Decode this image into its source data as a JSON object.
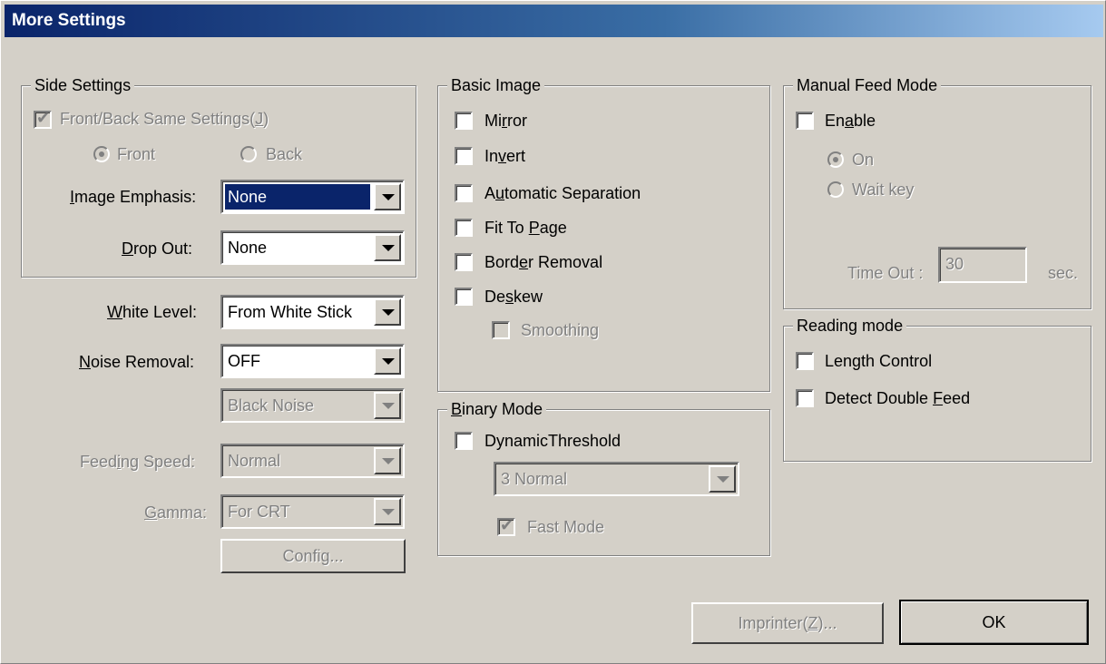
{
  "window": {
    "title": "More Settings"
  },
  "side_settings": {
    "title": "Side Settings",
    "same_settings": {
      "label_pre": "Front/Back Same Settings(",
      "label_key": "J",
      "label_post": ")",
      "checked": true,
      "enabled": false
    },
    "front": {
      "label": "Front",
      "selected": true,
      "enabled": false
    },
    "back": {
      "label": "Back",
      "selected": false,
      "enabled": false
    },
    "image_emphasis": {
      "label_pre": "",
      "label_key": "I",
      "label_post": "mage Emphasis:",
      "value": "None"
    },
    "drop_out": {
      "label_pre": "",
      "label_key": "D",
      "label_post": "rop Out:",
      "value": "None"
    }
  },
  "white_level": {
    "label_pre": "",
    "label_key": "W",
    "label_post": "hite Level:",
    "value": "From White Stick"
  },
  "noise_removal": {
    "label_pre": "",
    "label_key": "N",
    "label_post": "oise Removal:",
    "value": "OFF"
  },
  "black_noise": {
    "value": "Black Noise",
    "enabled": false
  },
  "feeding_speed": {
    "label_pre": "Feed",
    "label_key": "i",
    "label_post": "ng Speed:",
    "value": "Normal",
    "enabled": false
  },
  "gamma": {
    "label_pre": "",
    "label_key": "G",
    "label_post": "amma:",
    "value": "For CRT",
    "enabled": false
  },
  "config_button": {
    "label": "Config..."
  },
  "basic_image": {
    "title": "Basic Image",
    "mirror": {
      "pre": "Mi",
      "key": "r",
      "post": "ror"
    },
    "invert": {
      "pre": "In",
      "key": "v",
      "post": "ert"
    },
    "auto_sep": {
      "pre": "A",
      "key": "u",
      "post": "tomatic Separation"
    },
    "fit_to_page": {
      "pre": "Fit To ",
      "key": "P",
      "post": "age"
    },
    "border_removal": {
      "pre": "Bord",
      "key": "e",
      "post": "r Removal"
    },
    "deskew": {
      "pre": "De",
      "key": "s",
      "post": "kew"
    },
    "smoothing": {
      "label": "Smoothing",
      "enabled": false
    }
  },
  "binary_mode": {
    "title_pre": "",
    "title_key": "B",
    "title_post": "inary Mode",
    "dynamic_threshold": {
      "label": "DynamicThreshold"
    },
    "threshold_value": "3 Normal",
    "fast_mode": {
      "label": "Fast Mode",
      "checked": true,
      "enabled": false
    }
  },
  "manual_feed": {
    "title": "Manual Feed Mode",
    "enable": {
      "pre": "En",
      "key": "a",
      "post": "ble"
    },
    "on": {
      "label": "On",
      "selected": true,
      "enabled": false
    },
    "wait_key": {
      "label": "Wait key",
      "enabled": false
    },
    "timeout_label": "Time Out :",
    "timeout_value": "30",
    "timeout_unit": "sec."
  },
  "reading_mode": {
    "title": "Reading mode",
    "length_control": {
      "label": "Length Control"
    },
    "detect_double_feed": {
      "pre": "Detect Double ",
      "key": "F",
      "post": "eed"
    }
  },
  "imprinter_button": {
    "pre": "Imprinter(",
    "key": "Z",
    "post": ")..."
  },
  "ok_button": {
    "label": "OK"
  }
}
